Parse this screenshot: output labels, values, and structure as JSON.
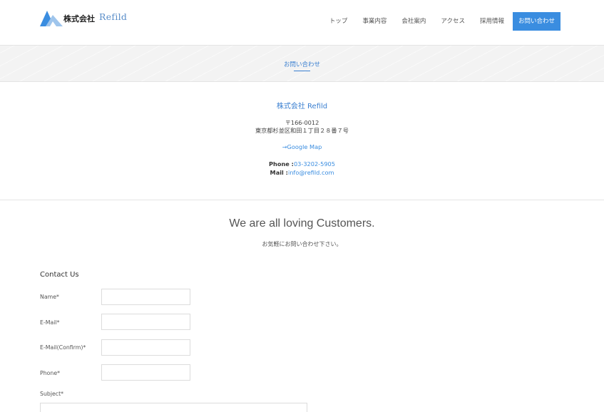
{
  "header": {
    "logo_jp": "株式会社",
    "logo_en": "Refild",
    "nav": [
      "トップ",
      "事業内容",
      "会社案内",
      "アクセス",
      "採用情報"
    ],
    "cta": "お問い合わせ"
  },
  "band": {
    "title": "お問い合わせ"
  },
  "company": {
    "name": "株式会社 Refild",
    "postal": "〒166-0012",
    "address": "東京都杉並区和田１丁目２８番７号",
    "map_link": "→Google Map",
    "phone_label": "Phone :",
    "phone_value": "03-3202-5905",
    "mail_label": "Mail :",
    "mail_value": "info@refild.com"
  },
  "welcome": {
    "title": "We are all loving Customers.",
    "subtitle": "お気軽にお問い合わせ下さい。"
  },
  "form": {
    "title": "Contact Us",
    "fields": [
      {
        "label": "Name*",
        "value": ""
      },
      {
        "label": "E-Mail*",
        "value": ""
      },
      {
        "label": "E-Mail(Confirm)*",
        "value": ""
      },
      {
        "label": "Phone*",
        "value": ""
      }
    ],
    "subject_label": "Subject*"
  },
  "colors": {
    "accent": "#3a8de0",
    "link": "#3a7fd0",
    "logo_light": "#9fc5ec"
  }
}
